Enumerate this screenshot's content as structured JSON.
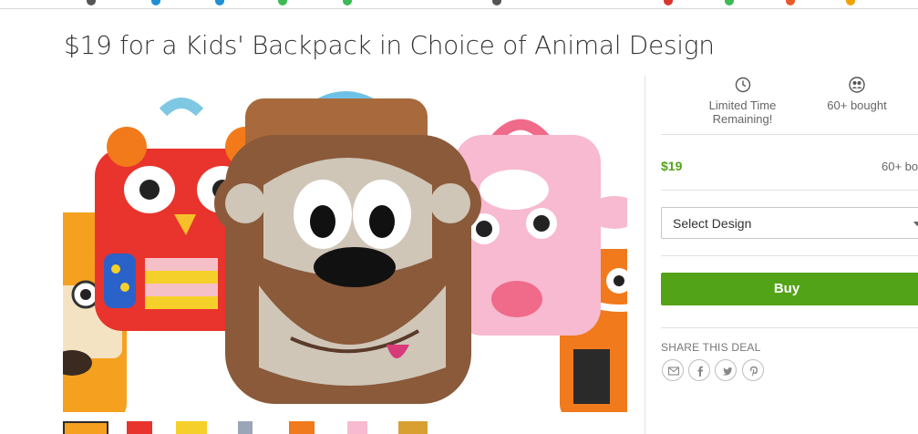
{
  "deal": {
    "title": "$19 for a Kids' Backpack in Choice of Animal Design",
    "hero_alt": "Kids' animal design backpacks: owl, monkey, sheep and tiger"
  },
  "stats": {
    "time_label": "Limited Time Remaining!",
    "bought_label": "60+ bought",
    "time_icon": "clock-icon",
    "bought_icon": "people-icon"
  },
  "option": {
    "price": "$19",
    "bought": "60+ bou"
  },
  "select": {
    "label": "Select Design"
  },
  "buy": {
    "label": "Buy"
  },
  "share": {
    "label": "SHARE THIS DEAL",
    "icons": [
      "email-icon",
      "facebook-icon",
      "twitter-icon",
      "pinterest-icon"
    ]
  },
  "colors": {
    "accent": "#53a318",
    "text": "#333333",
    "muted": "#666666",
    "divider": "#e2e2e2"
  }
}
